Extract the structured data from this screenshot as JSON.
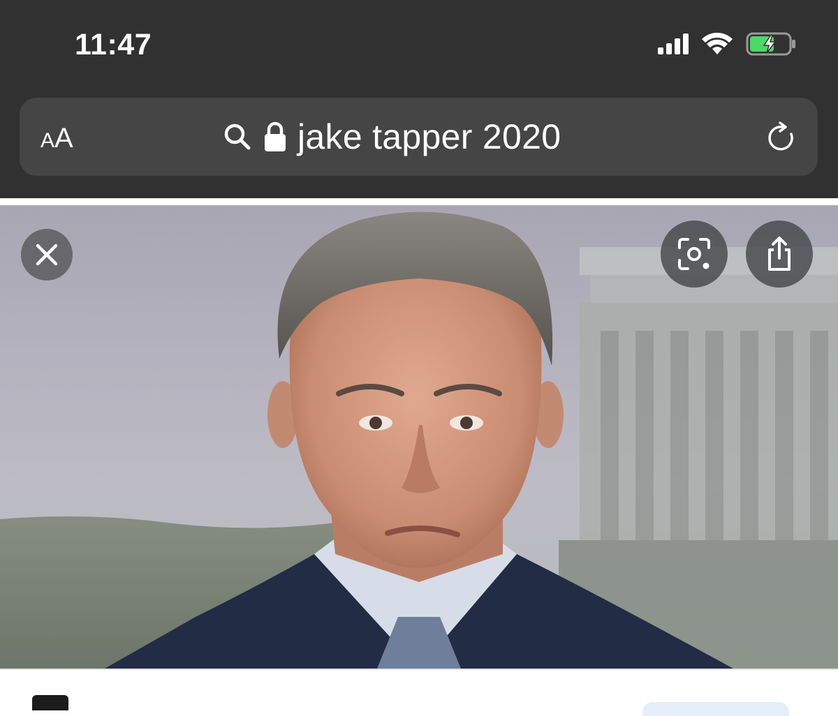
{
  "status_bar": {
    "time": "11:47"
  },
  "address_bar": {
    "reader_label_small": "A",
    "reader_label_large": "A",
    "query": "jake tapper 2020"
  },
  "image_viewer": {
    "buttons": [
      "close",
      "visual-lookup",
      "share"
    ]
  },
  "colors": {
    "chrome_bg": "#313131",
    "address_bg": "#454545",
    "battery_fill": "#4cd964"
  }
}
